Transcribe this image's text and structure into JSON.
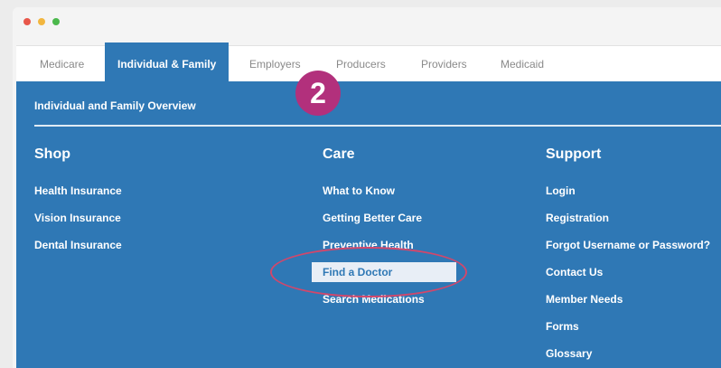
{
  "window_controls": {
    "close_color": "#e8574a",
    "minimize_color": "#f2b63f",
    "maximize_color": "#4bb84c"
  },
  "nav_tabs": [
    {
      "label": "Medicare"
    },
    {
      "label": "Individual & Family",
      "active": true
    },
    {
      "label": "Employers"
    },
    {
      "label": "Producers"
    },
    {
      "label": "Providers"
    },
    {
      "label": "Medicaid"
    }
  ],
  "panel": {
    "overview_link": "Individual and Family Overview",
    "accent_color": "#2f78b5"
  },
  "columns": {
    "shop": {
      "title": "Shop",
      "links": [
        "Health Insurance",
        "Vision Insurance",
        "Dental Insurance"
      ]
    },
    "care": {
      "title": "Care",
      "links": [
        "What to Know",
        "Getting Better Care",
        "Preventive Health",
        "Find a Doctor",
        "Search Medications"
      ],
      "highlighted": "Find a Doctor"
    },
    "support": {
      "title": "Support",
      "links": [
        "Login",
        "Registration",
        "Forgot Username or Password?",
        "Contact Us",
        "Member Needs",
        "Forms",
        "Glossary"
      ]
    }
  },
  "step_badge": {
    "number": "2",
    "color": "#b2307c"
  }
}
